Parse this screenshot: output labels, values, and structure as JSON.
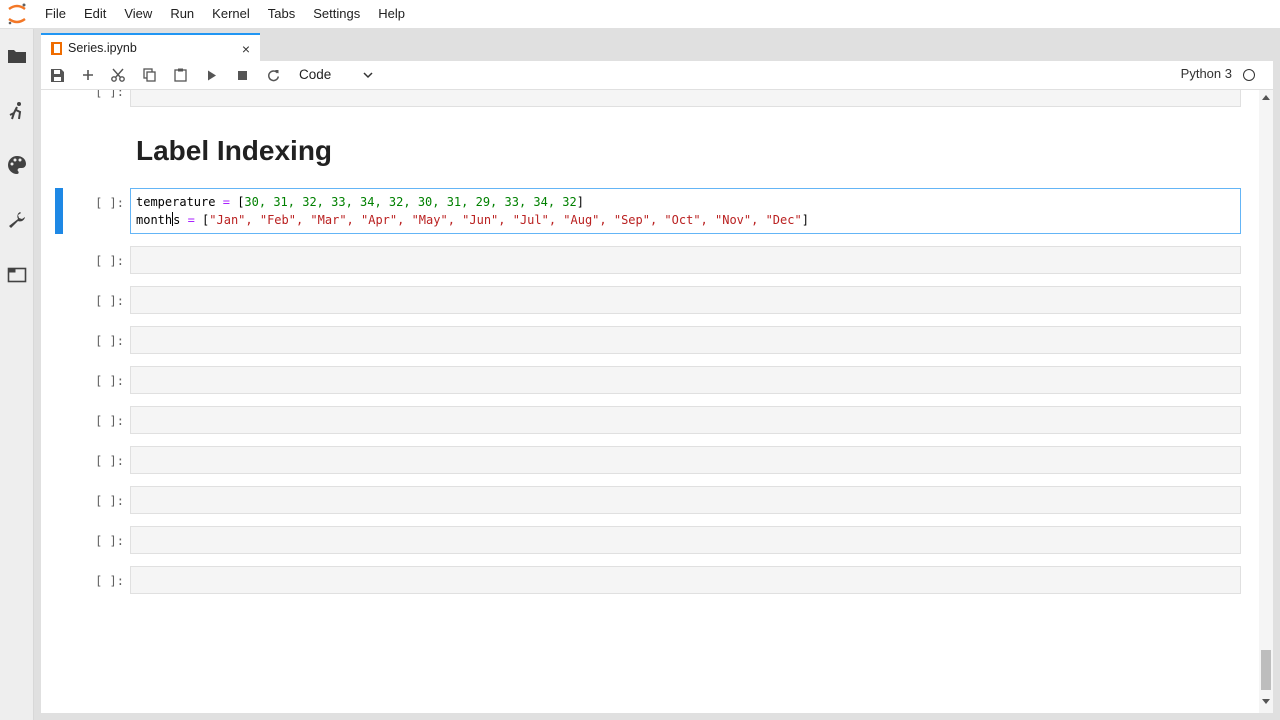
{
  "menu": [
    "File",
    "Edit",
    "View",
    "Run",
    "Kernel",
    "Tabs",
    "Settings",
    "Help"
  ],
  "sidebar_icons": [
    "folder-icon",
    "running-icon",
    "palette-icon",
    "wrench-icon",
    "tabs-icon"
  ],
  "tab": {
    "title": "Series.ipynb",
    "close": "×"
  },
  "toolbar": {
    "icons": [
      "save-icon",
      "add-cell-icon",
      "cut-icon",
      "copy-icon",
      "paste-icon",
      "run-icon",
      "stop-icon",
      "restart-icon"
    ],
    "cell_type": "Code",
    "kernel": "Python 3"
  },
  "notebook": {
    "prompt_empty": "[ ]:",
    "heading": "Label Indexing",
    "active_cell": {
      "line1": {
        "var": "temperature",
        "eq": "=",
        "open": "[",
        "values": "30, 31, 32, 33, 34, 32, 30, 31, 29, 33, 34, 32",
        "close": "]"
      },
      "line2": {
        "var_a": "month",
        "var_b": "s",
        "eq": "=",
        "list": "\"Jan\", \"Feb\", \"Mar\", \"Apr\", \"May\", \"Jun\", \"Jul\", \"Aug\", \"Sep\", \"Oct\", \"Nov\", \"Dec\""
      }
    },
    "empty_cell_count": 9
  },
  "colors": {
    "accent": "#1e88e5",
    "tab_border": "#2196f3",
    "keyword_op": "#aa22ff",
    "number": "#008000",
    "string": "#ba2121"
  }
}
